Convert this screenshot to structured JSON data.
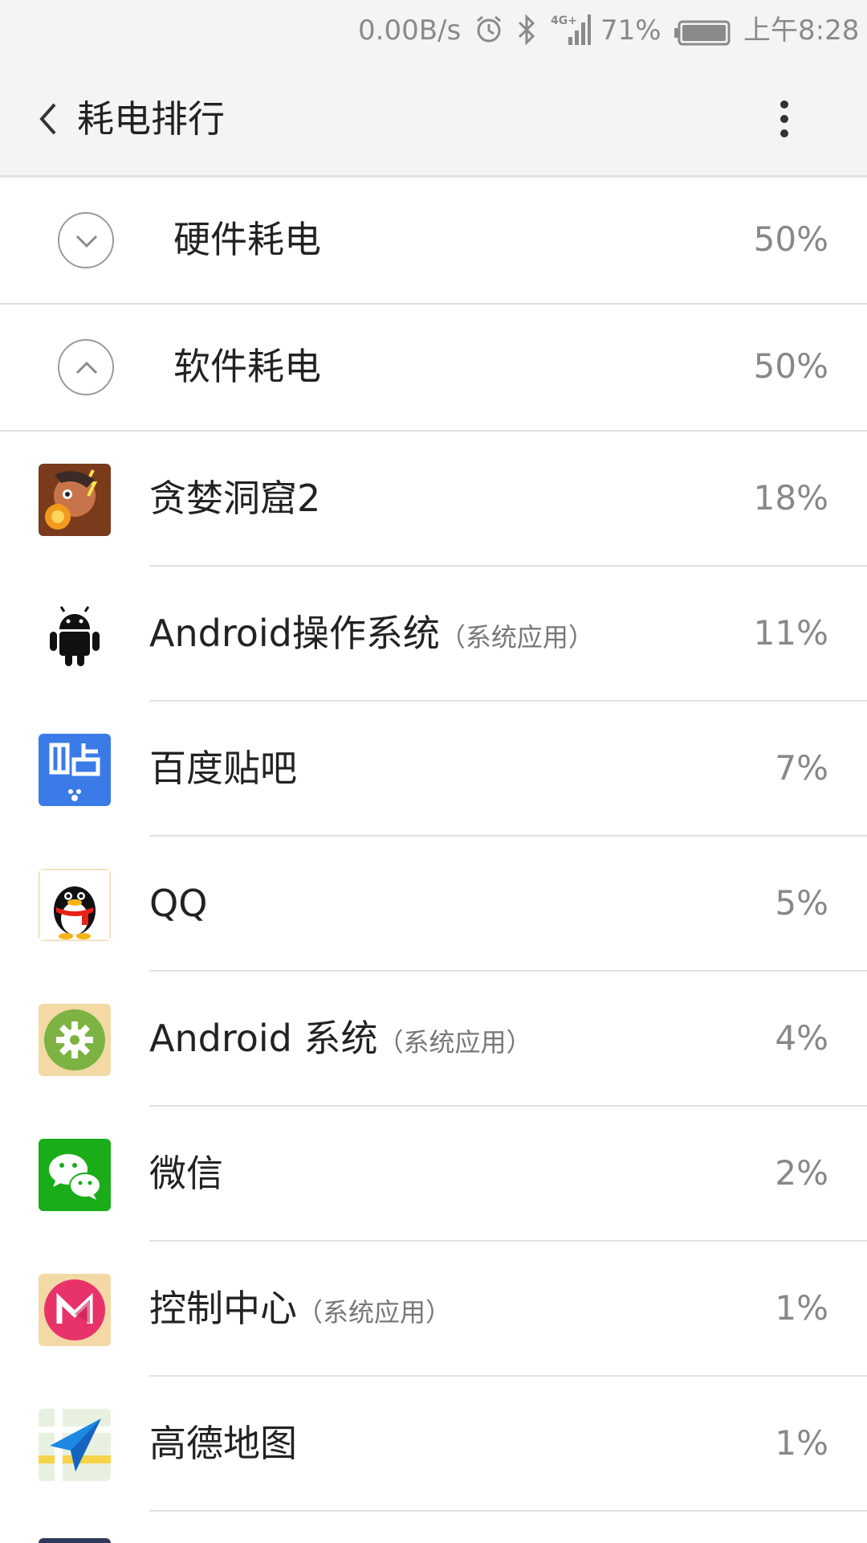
{
  "status_bar": {
    "net_speed": "0.00B/s",
    "network": "4G+",
    "battery": "71%",
    "time": "上午8:28",
    "icons": [
      "alarm-icon",
      "bluetooth-icon",
      "signal-icon",
      "battery-icon"
    ]
  },
  "app_bar": {
    "title": "耗电排行",
    "icons": [
      "back-arrow-icon",
      "more-vert-icon"
    ]
  },
  "sections": [
    {
      "label": "硬件耗电",
      "percent": "50%",
      "state": "collapsed",
      "icon": "chevron-down-icon"
    },
    {
      "label": "软件耗电",
      "percent": "50%",
      "state": "expanded",
      "icon": "chevron-up-icon"
    }
  ],
  "apps": [
    {
      "name": "贪婪洞窟2",
      "tag": "",
      "percent": "18%",
      "icon": "greedy-cave-icon"
    },
    {
      "name": "Android操作系统",
      "tag": "（系统应用）",
      "percent": "11%",
      "icon": "android-robot-icon"
    },
    {
      "name": "百度贴吧",
      "tag": "",
      "percent": "7%",
      "icon": "tieba-icon"
    },
    {
      "name": "QQ",
      "tag": "",
      "percent": "5%",
      "icon": "qq-penguin-icon"
    },
    {
      "name": "Android 系统",
      "tag": "（系统应用）",
      "percent": "4%",
      "icon": "gear-icon"
    },
    {
      "name": "微信",
      "tag": "",
      "percent": "2%",
      "icon": "wechat-icon"
    },
    {
      "name": "控制中心",
      "tag": "（系统应用）",
      "percent": "1%",
      "icon": "control-center-icon"
    },
    {
      "name": "高德地图",
      "tag": "",
      "percent": "1%",
      "icon": "amap-icon"
    }
  ],
  "colors": {
    "app_bar_bg": "#f4f4f4",
    "divider": "#e2e2e2",
    "percent_text": "#888888",
    "tieba_blue": "#3b7be8",
    "wechat_green": "#1aad19"
  }
}
